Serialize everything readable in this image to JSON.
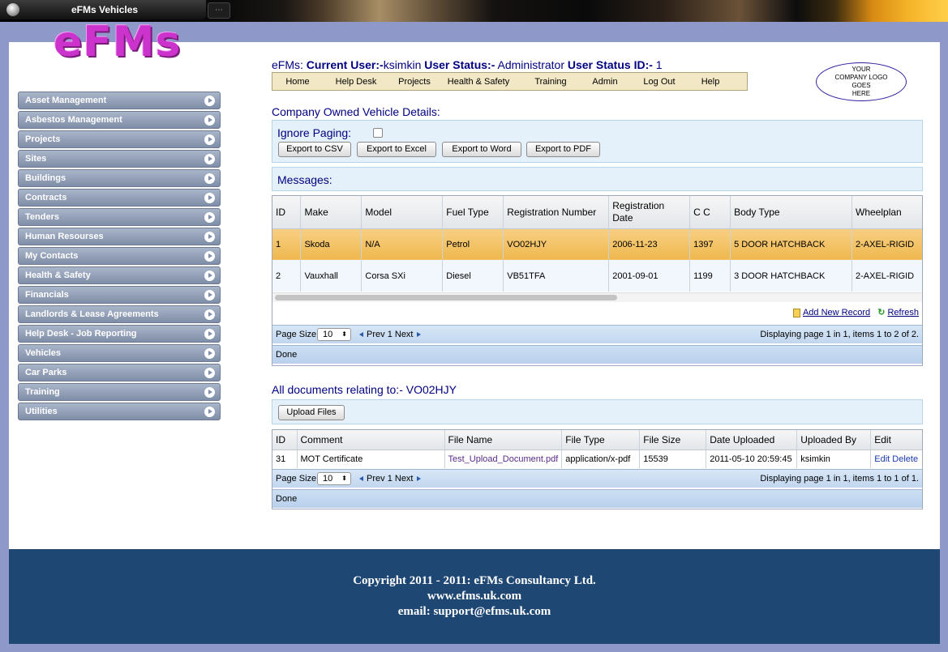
{
  "window": {
    "title": "eFMs Vehicles"
  },
  "logo": {
    "text": "eFMs"
  },
  "sidebar": {
    "items": [
      {
        "label": "Asset Management"
      },
      {
        "label": "Asbestos Management"
      },
      {
        "label": "Projects"
      },
      {
        "label": "Sites"
      },
      {
        "label": "Buildings"
      },
      {
        "label": "Contracts"
      },
      {
        "label": "Tenders"
      },
      {
        "label": "Human Resourses"
      },
      {
        "label": "My Contacts"
      },
      {
        "label": "Health & Safety"
      },
      {
        "label": "Financials"
      },
      {
        "label": "Landlords & Lease Agreements"
      },
      {
        "label": "Help Desk - Job Reporting"
      },
      {
        "label": "Vehicles"
      },
      {
        "label": "Car Parks"
      },
      {
        "label": "Training"
      },
      {
        "label": "Utilities"
      }
    ]
  },
  "header": {
    "prefix": "eFMs:",
    "current_user_label": "Current User:-",
    "current_user": "ksimkin",
    "user_status_label": "User Status:-",
    "user_status": "Administrator",
    "user_status_id_label": "User Status ID:-",
    "user_status_id": "1"
  },
  "nav": {
    "items": [
      {
        "label": "Home"
      },
      {
        "label": "Help Desk"
      },
      {
        "label": "Projects"
      },
      {
        "label": "Health & Safety"
      },
      {
        "label": "Training"
      },
      {
        "label": "Admin"
      },
      {
        "label": "Log Out"
      },
      {
        "label": "Help"
      }
    ]
  },
  "company_logo": {
    "line1": "YOUR",
    "line2": "COMPANY LOGO",
    "line3": "GOES",
    "line4": "HERE"
  },
  "vehicle_section": {
    "title": "Company Owned Vehicle Details:",
    "ignore_paging_label": "Ignore Paging:",
    "ignore_paging_checked": false,
    "export_csv": "Export to CSV",
    "export_excel": "Export to Excel",
    "export_word": "Export to Word",
    "export_pdf": "Export to PDF",
    "messages_label": "Messages:"
  },
  "vehicle_grid": {
    "columns": [
      "ID",
      "Make",
      "Model",
      "Fuel Type",
      "Registration Number",
      "Registration Date",
      "C C",
      "Body Type",
      "Wheelplan"
    ],
    "rows": [
      [
        "1",
        "Skoda",
        "N/A",
        "Petrol",
        "VO02HJY",
        "2006-11-23",
        "1397",
        "5 DOOR HATCHBACK",
        "2-AXEL-RIGID"
      ],
      [
        "2",
        "Vauxhall",
        "Corsa SXi",
        "Diesel",
        "VB51TFA",
        "2001-09-01",
        "1199",
        "3 DOOR HATCHBACK",
        "2-AXEL-RIGID"
      ]
    ],
    "selected_row": 0,
    "add_new_record": "Add New Record",
    "refresh": "Refresh",
    "page_size_label": "Page Size:",
    "page_size": "10",
    "prev": "Prev",
    "page": "1",
    "next": "Next",
    "page_info": "Displaying page 1 in 1, items 1 to 2 of 2.",
    "status": "Done"
  },
  "documents_section": {
    "title": "All documents relating to:- VO02HJY",
    "upload_button": "Upload Files"
  },
  "documents_grid": {
    "columns": [
      "ID",
      "Comment",
      "File Name",
      "File Type",
      "File Size",
      "Date Uploaded",
      "Uploaded By",
      "Edit"
    ],
    "rows": [
      [
        "31",
        "MOT Certificate",
        "Test_Upload_Document.pdf",
        "application/x-pdf",
        "15539",
        "2011-05-10 20:59:45",
        "ksimkin"
      ]
    ],
    "edit_label": "Edit",
    "delete_label": "Delete",
    "page_size_label": "Page Size:",
    "page_size": "10",
    "prev": "Prev",
    "page": "1",
    "next": "Next",
    "page_info": "Displaying page 1 in 1, items 1 to 1 of 1.",
    "status": "Done"
  },
  "footer": {
    "copyright": "Copyright 2011 - 2011: eFMs Consultancy Ltd.",
    "website": "www.efms.uk.com",
    "email": "email: support@efms.uk.com"
  },
  "colors": {
    "background": "#8f99c9",
    "accent": "#000080",
    "selected_row": "#efb84e",
    "footer": "#1e4873",
    "logo": "#cc33cc"
  }
}
